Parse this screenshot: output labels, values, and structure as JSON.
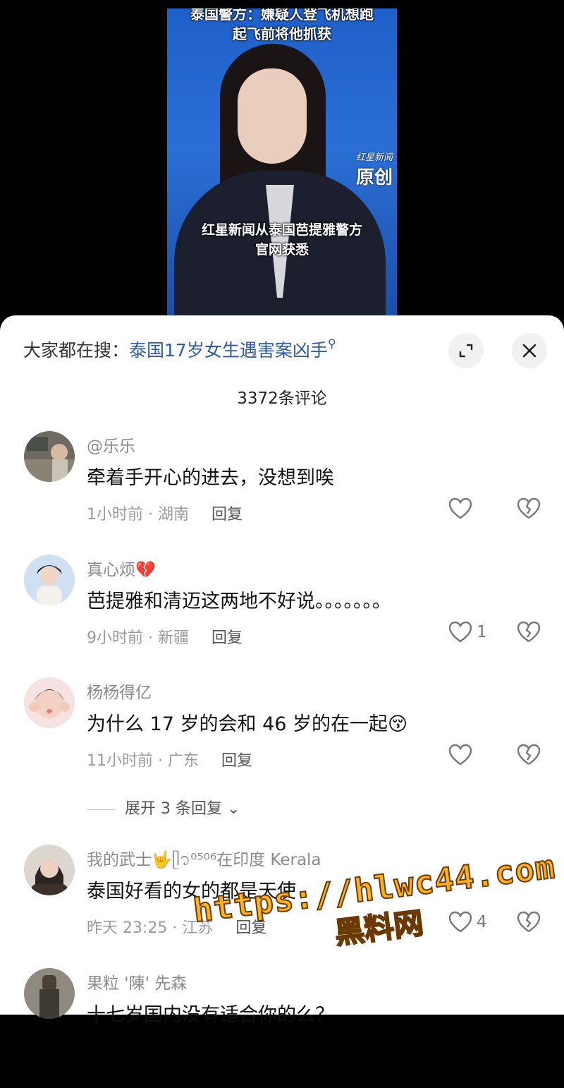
{
  "video": {
    "title_line1": "泰国警方：嫌疑人登飞机想跑",
    "title_line2": "起飞前将他抓获",
    "brand_small": "红星新闻",
    "brand_large": "原创",
    "caption_line1": "红星新闻从泰国芭提雅警方",
    "caption_line2": "官网获悉"
  },
  "search": {
    "prefix": "大家都在搜：",
    "keyword": "泰国17岁女生遇害案凶手",
    "search_icon": "search-icon"
  },
  "header": {
    "comment_count": "3372条评论",
    "expand_icon": "expand-icon",
    "close_icon": "close-icon"
  },
  "comments": [
    {
      "username": "@乐乐",
      "text": "牵着手开心的进去，没想到唉",
      "time_location": "1小时前 · 湖南",
      "reply_label": "回复",
      "likes": ""
    },
    {
      "username": "真心烦💔",
      "text": "芭提雅和清迈这两地不好说。。。。。。。",
      "time_location": "9小时前 · 新疆",
      "reply_label": "回复",
      "likes": "1"
    },
    {
      "username": "杨杨得亿",
      "text": "为什么 17 岁的会和 46 岁的在一起😚",
      "time_location": "11小时前 · 广东",
      "reply_label": "回复",
      "likes": ""
    },
    {
      "username": "我的武士🤟ᥫ᭡⁰⁵⁰⁶在印度 Kerala",
      "text": "泰国好看的女的都是天使",
      "time_location": "昨天 23:25 · 江苏",
      "reply_label": "回复",
      "likes": "4"
    },
    {
      "username": "果粒 '陳' 先森",
      "text": "十七岁国内没有适合你的么？",
      "time_location": "",
      "reply_label": "",
      "likes": ""
    }
  ],
  "expand_replies": "展开 3 条回复",
  "watermark": {
    "line1": "https://hlwc44.com",
    "line2": "黑料网"
  }
}
